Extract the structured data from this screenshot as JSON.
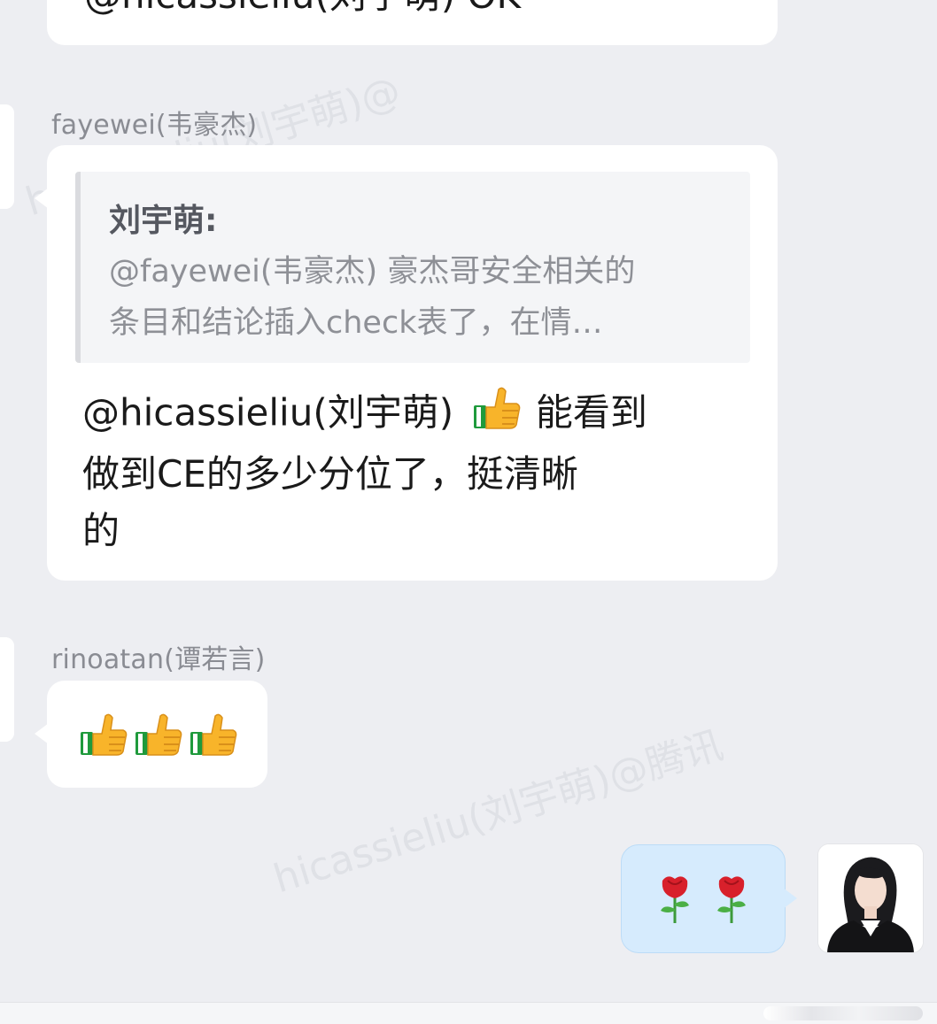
{
  "top_message": {
    "text": "@hicassieliu(刘宇萌) OK"
  },
  "message_1": {
    "sender": "fayewei(韦豪杰)",
    "quote": {
      "author": "刘宇萌:",
      "line1": "@fayewei(韦豪杰) 豪杰哥安全相关的",
      "line2": "条目和结论插入check表了，在情…"
    },
    "mention": "@hicassieliu(刘宇萌)",
    "line1_rest": "能看到",
    "line2": "做到CE的多少分位了，挺清晰",
    "line3": "的",
    "reaction_icon": "thumbs-up-emoji"
  },
  "message_2": {
    "sender": "rinoatan(谭若言)",
    "emoji_count": 3,
    "emoji_icon": "thumbs-up-emoji"
  },
  "message_3": {
    "emoji_icon": "rose-emoji",
    "emoji_count": 2
  },
  "watermarks": [
    "hicassieliu(刘宇萌)@",
    "hicassieliu(刘宇萌)@腾讯"
  ],
  "colors": {
    "background": "#EDEEF2",
    "bubble": "#FFFFFF",
    "my_bubble": "#D6EBFD",
    "sender_name": "#8A8C93",
    "quote_text": "#8E9096"
  }
}
